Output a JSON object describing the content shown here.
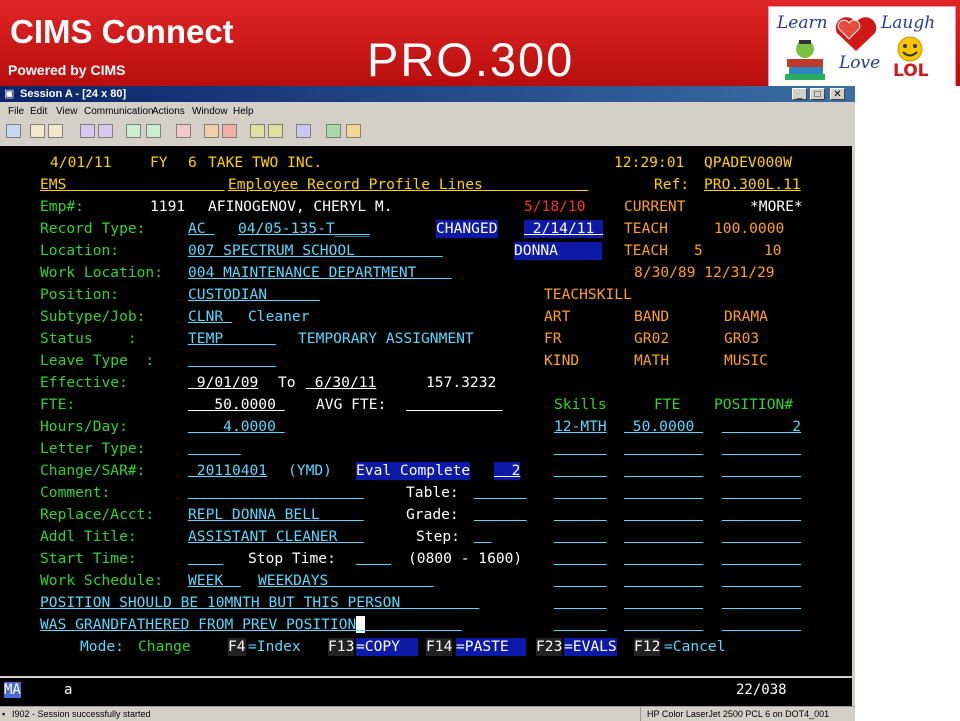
{
  "slide": {
    "brand": "CIMS Connect",
    "powered": "Powered by CIMS",
    "title": "PRO.300",
    "logo_words": [
      "Learn",
      "Laugh",
      "Love",
      "LOL"
    ]
  },
  "window": {
    "title": "Session A - [24 x 80]",
    "menu": [
      "File",
      "Edit",
      "View",
      "Communication",
      "Actions",
      "Window",
      "Help"
    ],
    "buttons": {
      "minimize": "_",
      "maximize": "□",
      "close": "✕"
    }
  },
  "screen": {
    "header": {
      "date": "4/01/11",
      "fy_label": "FY",
      "fy": "6",
      "org": "TAKE TWO INC.",
      "time": "12:29:01",
      "workstation": "QPADEV000W",
      "system": "EMS",
      "screen_title": "Employee Record Profile Lines",
      "ref_label": "Ref:",
      "ref": "PRO.300L.11"
    },
    "employee": {
      "label": "Emp#:",
      "number": "1191",
      "name": "AFINOGENOV, CHERYL M.",
      "date": "5/18/10",
      "status": "CURRENT",
      "more": "*MORE*"
    },
    "fields": {
      "record_type_label": "Record Type:",
      "record_type": "AC",
      "record_code": "04/05-135-T",
      "changed_label": "CHANGED",
      "changed_date": "2/14/11",
      "changed_by": "DONNA",
      "location_label": "Location:",
      "location": "007 SPECTRUM SCHOOL",
      "work_location_label": "Work Location:",
      "work_location": "004 MAINTENANCE DEPARTMENT",
      "position_label": "Position:",
      "position": "CUSTODIAN",
      "subtype_label": "Subtype/Job:",
      "subtype": "CLNR",
      "subtype_desc": "Cleaner",
      "status_label": "Status    :",
      "status": "TEMP",
      "status_desc": "TEMPORARY ASSIGNMENT",
      "leave_label": "Leave Type  :",
      "effective_label": "Effective:",
      "effective_from": "9/01/09",
      "to_label": "To",
      "effective_to": "6/30/11",
      "effective_value": "157.3232",
      "fte_label": "FTE:",
      "fte": "50.0000",
      "avg_fte_label": "AVG FTE:",
      "hours_label": "Hours/Day:",
      "hours": "4.0000",
      "letter_label": "Letter Type:",
      "change_label": "Change/SAR#:",
      "change": "20110401",
      "change_fmt": "(YMD)",
      "eval_label": "Eval Complete",
      "eval_value": "2",
      "comment_label": "Comment:",
      "table_label": "Table:",
      "replace_label": "Replace/Acct:",
      "replace": "REPL DONNA BELL",
      "grade_label": "Grade:",
      "title_label": "Addl Title:",
      "title": "ASSISTANT CLEANER",
      "step_label": "Step:",
      "start_label": "Start Time:",
      "stop_label": "Stop Time:",
      "time_range": "(0800 - 1600)",
      "schedule_label": "Work Schedule:",
      "schedule": "WEEK",
      "schedule_desc": "WEEKDAYS",
      "note1": "POSITION SHOULD BE 10MNTH BUT THIS PERSON",
      "note2": "WAS GRANDFATHERED FROM PREV POSITION"
    },
    "right_panel": {
      "teach1": "TEACH",
      "teach1_value": "100.0000",
      "teach2": "TEACH",
      "teach2_a": "5",
      "teach2_b": "10",
      "dates": "8/30/89 12/31/29",
      "teachskill": "TEACHSKILL",
      "skills_grid": [
        [
          "ART",
          "BAND",
          "DRAMA"
        ],
        [
          "FR",
          "GR02",
          "GR03"
        ],
        [
          "KIND",
          "MATH",
          "MUSIC"
        ]
      ],
      "col_skills": "Skills",
      "col_fte": "FTE",
      "col_position": "POSITION#",
      "row_skill": "12-MTH",
      "row_fte": "50.0000",
      "row_position": "2"
    },
    "footer": {
      "mode_label": "Mode:",
      "mode": "Change",
      "f4": "F4",
      "f4_label": "=Index",
      "f13": "F13",
      "f13_label": "=COPY",
      "f14": "F14",
      "f14_label": "=PASTE",
      "f23": "F23",
      "f23_label": "=EVALS",
      "f12": "F12",
      "f12_label": "=Cancel"
    }
  },
  "oia": {
    "left": "MA",
    "indicator": "a",
    "position": "22/038"
  },
  "status_bar": {
    "message": "I902 - Session successfully started",
    "printer": "HP Color LaserJet 2500 PCL 6 on DOT4_001"
  },
  "colors": {
    "banner_red": "#d01818",
    "screen_bg": "#000000",
    "field_green": "#32d232",
    "input_cyan": "#5ad8ff",
    "highlight_blue": "#0d1aa8"
  }
}
